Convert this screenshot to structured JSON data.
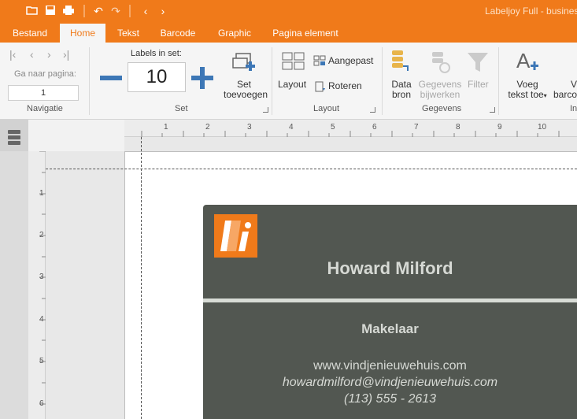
{
  "app": {
    "title": "Labeljoy Full - busines"
  },
  "tabs": [
    {
      "label": "Bestand",
      "active": false
    },
    {
      "label": "Home",
      "active": true
    },
    {
      "label": "Tekst",
      "active": false
    },
    {
      "label": "Barcode",
      "active": false
    },
    {
      "label": "Graphic",
      "active": false
    },
    {
      "label": "Pagina element",
      "active": false
    }
  ],
  "ribbon": {
    "navigation": {
      "goto_label": "Ga naar pagina:",
      "page_value": "1",
      "group_label": "Navigatie"
    },
    "set": {
      "labels_in_set_label": "Labels in set:",
      "labels_value": "10",
      "add_set_label_1": "Set",
      "add_set_label_2": "toevoegen",
      "group_label": "Set"
    },
    "layout": {
      "layout_label": "Layout",
      "custom_label": "Aangepast",
      "rotate_label": "Roteren",
      "group_label": "Layout"
    },
    "data": {
      "source_label_1": "Data",
      "source_label_2": "bron",
      "update_label_1": "Gegevens",
      "update_label_2": "bijwerken",
      "filter_label": "Filter",
      "group_label": "Gegevens"
    },
    "insert": {
      "add_text_label_1": "Voeg",
      "add_text_label_2": "tekst toe",
      "add_barcode_label_1": "V",
      "add_barcode_label_2": "barco",
      "group_label": "In"
    }
  },
  "rulers": {
    "top": [
      "1",
      "2",
      "3",
      "4",
      "5",
      "6",
      "7",
      "8",
      "9",
      "10"
    ],
    "left": [
      "1",
      "2",
      "3",
      "4",
      "5",
      "6"
    ]
  },
  "card": {
    "name": "Howard Milford",
    "role": "Makelaar",
    "website": "www.vindjenieuwehuis.com",
    "email": "howardmilford@vindjenieuwehuis.com",
    "phone": "(113) 555 - 2613",
    "colors": {
      "background": "#525751",
      "logo": "#f07a1a",
      "text": "#d6d9d4"
    }
  },
  "colors": {
    "accent": "#f07a1a",
    "ribbon_bg": "#f5f5f5",
    "plus_minus": "#3d77b6"
  }
}
